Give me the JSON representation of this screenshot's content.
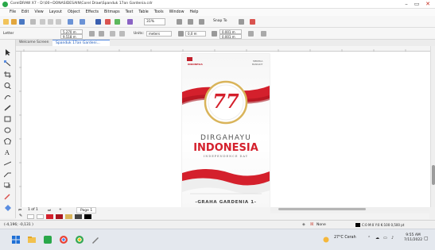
{
  "window": {
    "title": "CorelDRAW X7 - D:\\00~DONASIDESAIN\\Corel Draw\\Spanduk 17an Gardenia.cdr",
    "minimize": "–",
    "maximize": "▭",
    "close": "✕"
  },
  "menu": [
    "File",
    "Edit",
    "View",
    "Layout",
    "Object",
    "Effects",
    "Bitmaps",
    "Text",
    "Table",
    "Tools",
    "Window",
    "Help"
  ],
  "toolbar": {
    "zoom": "31%",
    "snap_label": "Snap To"
  },
  "property_bar": {
    "preset": "Letter",
    "width": "5,270 m",
    "height": "9,518 m",
    "units_label": "Units:",
    "units": "meters",
    "nudge": "0,0 m",
    "dup_x": "0,001 m",
    "dup_y": "0,001 m"
  },
  "tabs": {
    "welcome": "Welcome Screen",
    "file": "Spanduk 17an Gardeni..."
  },
  "page_nav": {
    "count": "1 of 1",
    "page": "Page 1"
  },
  "status": {
    "coords": "(-4,196; -0,131 )",
    "fill": "None",
    "color_info": "C:0 M:0 Y:0 K:100 0,500 pt"
  },
  "taskbar": {
    "weather": "27°C Cerah",
    "time": "9:55 AM",
    "date": "7/11/2022"
  },
  "poster": {
    "logo_text": "INDONESIA",
    "right_text_1": "MEREKA",
    "right_text_2": "BANGKIT",
    "seventy_seven": "77",
    "dirgahayu": "DIRGAHAYU",
    "indonesia": "INDONESIA",
    "independence": "INDEPENDENCE DAY",
    "footer": "-GRAHA GARDENIA 1-"
  },
  "colors": {
    "poster_red": "#d4202c",
    "accent_blue": "#1a56b8"
  }
}
